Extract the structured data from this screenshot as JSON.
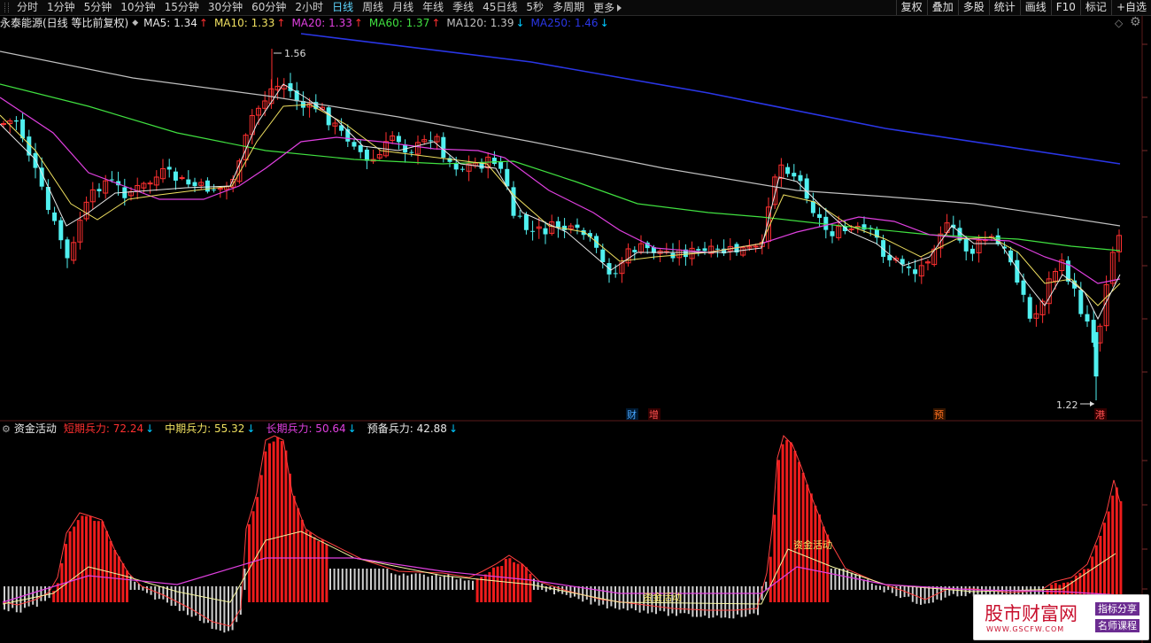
{
  "toolbar": {
    "timeframes": [
      "分时",
      "1分钟",
      "5分钟",
      "10分钟",
      "15分钟",
      "30分钟",
      "60分钟",
      "2小时",
      "日线",
      "周线",
      "月线",
      "年线",
      "季线",
      "45日线",
      "5秒",
      "多周期",
      "更多"
    ],
    "active": "日线",
    "right_buttons": [
      "复权",
      "叠加",
      "多股",
      "统计",
      "画线",
      "F10",
      "标记",
      "+自选"
    ]
  },
  "main_panel": {
    "title": "永泰能源(日线 等比前复权)",
    "ma": [
      {
        "label": "MA5: 1.34",
        "arrow": "↑",
        "color": "#e8e8e8"
      },
      {
        "label": "MA10: 1.33",
        "arrow": "↑",
        "color": "#f0e060"
      },
      {
        "label": "MA20: 1.33",
        "arrow": "↑",
        "color": "#e040e0"
      },
      {
        "label": "MA60: 1.37",
        "arrow": "↑",
        "color": "#40e040"
      },
      {
        "label": "MA120: 1.39",
        "arrow": "↓",
        "color": "#c0c0c0"
      },
      {
        "label": "MA250: 1.46",
        "arrow": "↓",
        "color": "#2a36e6"
      }
    ],
    "high_label": "1.56",
    "low_label": "1.22",
    "event_markers": [
      {
        "text": "财",
        "color": "#4aa8ff",
        "bg": "#001a33"
      },
      {
        "text": "增",
        "color": "#ff5050",
        "bg": "#330000"
      },
      {
        "text": "预",
        "color": "#ff7020",
        "bg": "#331500"
      },
      {
        "text": "港",
        "color": "#ff5050",
        "bg": "#330000"
      }
    ],
    "price_range": [
      1.18,
      1.6
    ]
  },
  "indicator_panel": {
    "title": "资金活动",
    "values": [
      {
        "label": "短期兵力: 72.24",
        "arrow": "↓",
        "color": "#ff3030"
      },
      {
        "label": "中期兵力: 55.32",
        "arrow": "↓",
        "color": "#f0e060"
      },
      {
        "label": "长期兵力: 50.64",
        "arrow": "↓",
        "color": "#e040e0"
      },
      {
        "label": "预备兵力: 42.88",
        "arrow": "↓",
        "color": "#e8e8e8"
      }
    ],
    "annotations": [
      "资金活动",
      "资金活动"
    ]
  },
  "watermark": {
    "main": "股市财富网",
    "url": "WWW.GSCFW.COM",
    "tag1": "指标分享",
    "tag2": "名师课程"
  },
  "colors": {
    "up_candle": "#ff3030",
    "down_candle": "#50f0f0",
    "ma5": "#e8e8e8",
    "ma10": "#f0e060",
    "ma20": "#e040e0",
    "ma60": "#40e040",
    "ma120": "#c0c0c0",
    "ma250": "#2a36e6"
  }
}
